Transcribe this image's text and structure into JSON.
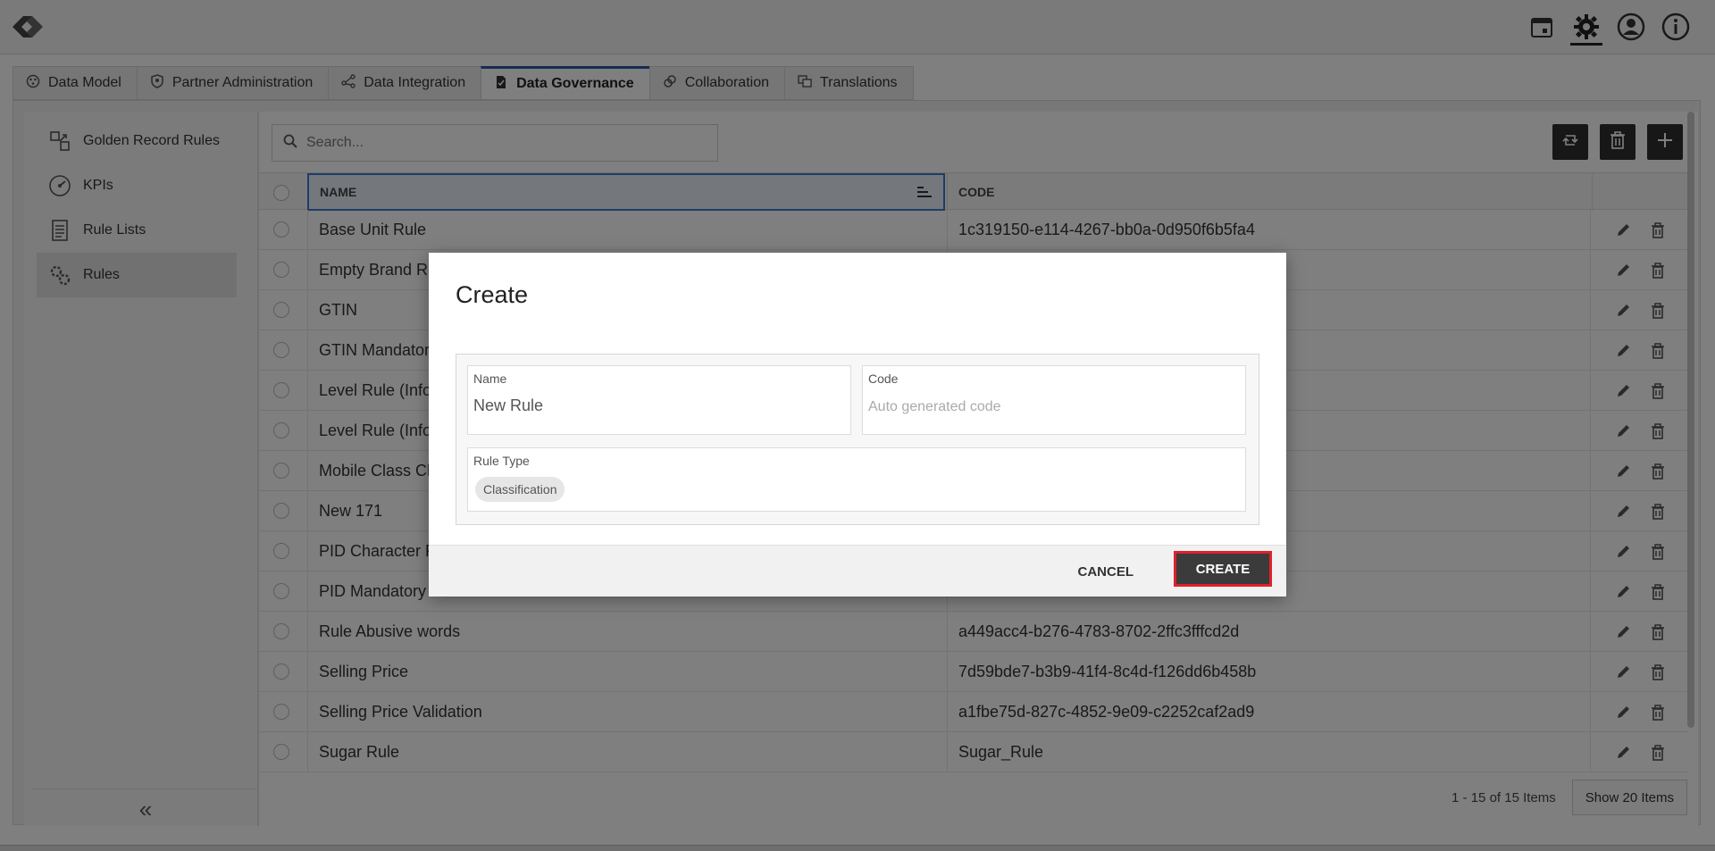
{
  "header": {
    "logo": "company-logo",
    "icons": [
      "calendar-icon",
      "gear-icon",
      "user-icon",
      "info-icon"
    ]
  },
  "module_tabs": [
    {
      "label": "Data Model",
      "icon": "palette-icon"
    },
    {
      "label": "Partner Administration",
      "icon": "shield-icon"
    },
    {
      "label": "Data Integration",
      "icon": "integration-icon"
    },
    {
      "label": "Data Governance",
      "icon": "document-icon",
      "active": true
    },
    {
      "label": "Collaboration",
      "icon": "link-icon"
    },
    {
      "label": "Translations",
      "icon": "translate-icon"
    }
  ],
  "sidebar": {
    "items": [
      {
        "label": "Golden Record Rules",
        "icon": "golden-record-icon"
      },
      {
        "label": "KPIs",
        "icon": "gauge-icon"
      },
      {
        "label": "Rule Lists",
        "icon": "list-icon"
      },
      {
        "label": "Rules",
        "icon": "gears-icon",
        "active": true
      }
    ],
    "collapse": "«"
  },
  "search": {
    "placeholder": "Search..."
  },
  "grid": {
    "columns": {
      "name": "NAME",
      "code": "CODE"
    },
    "rows": [
      {
        "name": "Base Unit Rule",
        "code": "1c319150-e114-4267-bb0a-0d950f6b5fa4"
      },
      {
        "name": "Empty Brand Ru",
        "code": ""
      },
      {
        "name": "GTIN",
        "code": ""
      },
      {
        "name": "GTIN Mandator",
        "code": ""
      },
      {
        "name": "Level Rule (Info",
        "code": ""
      },
      {
        "name": "Level Rule (Info",
        "code": ""
      },
      {
        "name": "Mobile Class Cl",
        "code": ""
      },
      {
        "name": "New 171",
        "code": ""
      },
      {
        "name": "PID Character R",
        "code": ""
      },
      {
        "name": "PID Mandatory",
        "code": ""
      },
      {
        "name": "Rule Abusive words",
        "code": "a449acc4-b276-4783-8702-2ffc3fffcd2d"
      },
      {
        "name": "Selling Price",
        "code": "7d59bde7-b3b9-41f4-8c4d-f126dd6b458b"
      },
      {
        "name": "Selling Price Validation",
        "code": "a1fbe75d-827c-4852-9e09-c2252caf2ad9"
      },
      {
        "name": "Sugar Rule",
        "code": "Sugar_Rule"
      }
    ]
  },
  "pager": {
    "summary": "1 - 15 of 15 Items",
    "page_size_button": "Show 20 Items"
  },
  "modal": {
    "title": "Create",
    "name_label": "Name",
    "name_value": "New Rule",
    "code_label": "Code",
    "code_placeholder": "Auto generated code",
    "rule_type_label": "Rule Type",
    "rule_type_value": "Classification",
    "cancel": "CANCEL",
    "create": "CREATE",
    "highlight_color": "#e0202a"
  }
}
